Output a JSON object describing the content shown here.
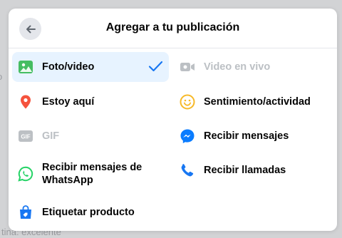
{
  "background": {
    "bottom_text": "tina: excelente",
    "left_glyph": "o"
  },
  "dialog": {
    "title": "Agregar a tu publicación",
    "back_icon": "arrow-left-icon",
    "options": [
      {
        "label": "Foto/video",
        "icon": "photo-icon",
        "color": "#45bd62",
        "selected": true,
        "disabled": false
      },
      {
        "label": "Video en vivo",
        "icon": "video-camera-icon",
        "color": "#bcc0c4",
        "selected": false,
        "disabled": true
      },
      {
        "label": "Estoy aquí",
        "icon": "location-pin-icon",
        "color": "#f5533d",
        "selected": false,
        "disabled": false
      },
      {
        "label": "Sentimiento/actividad",
        "icon": "smiley-icon",
        "color": "#f7b928",
        "selected": false,
        "disabled": false
      },
      {
        "label": "GIF",
        "icon": "gif-icon",
        "color": "#bcc0c4",
        "selected": false,
        "disabled": true
      },
      {
        "label": "Recibir mensajes",
        "icon": "messenger-icon",
        "color": "#0a7cff",
        "selected": false,
        "disabled": false
      },
      {
        "label": "Recibir mensajes de WhatsApp",
        "icon": "whatsapp-icon",
        "color": "#25d366",
        "selected": false,
        "disabled": false
      },
      {
        "label": "Recibir llamadas",
        "icon": "phone-icon",
        "color": "#1877f2",
        "selected": false,
        "disabled": false
      },
      {
        "label": "Etiquetar producto",
        "icon": "shopping-bag-icon",
        "color": "#1877f2",
        "selected": false,
        "disabled": false
      }
    ]
  },
  "colors": {
    "accent": "#1877f2",
    "selected_bg": "#e7f3ff",
    "disabled": "#bcc0c4"
  }
}
